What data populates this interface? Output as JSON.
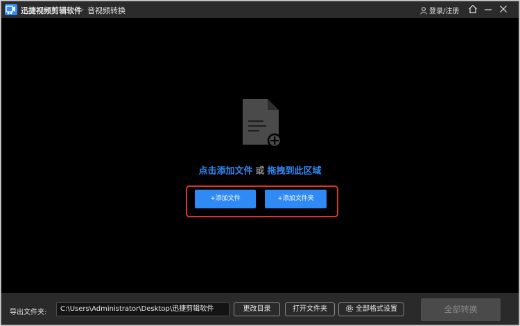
{
  "titlebar": {
    "app_name": "迅捷视频剪辑软件",
    "separator": "-",
    "subtitle": "音视频转换",
    "login_label": "登录/注册",
    "icons": [
      "logo-icon",
      "user-icon",
      "home-icon",
      "minimize-icon",
      "close-icon"
    ]
  },
  "main": {
    "drop_icon": "document-add-icon",
    "hint": {
      "click_add": "点击添加文件",
      "or": "或",
      "drag_here": "拖拽到此区域"
    },
    "add_file_label": "+添加文件",
    "add_folder_label": "+添加文件夹",
    "highlight_color": "#e0332c"
  },
  "bottom": {
    "output_label": "导出文件夹:",
    "output_path": "C:\\Users\\Administrator\\Desktop\\迅捷剪辑软件",
    "change_dir_label": "更改目录",
    "open_folder_label": "打开文件夹",
    "format_settings_label": "全部格式设置",
    "convert_all_label": "全部转换"
  },
  "colors": {
    "accent": "#2f8af5",
    "background": "#000000",
    "titlebar": "#2b2b2b",
    "bottombar": "#2a2a2a",
    "disabled_button": "#4a4a4a"
  }
}
